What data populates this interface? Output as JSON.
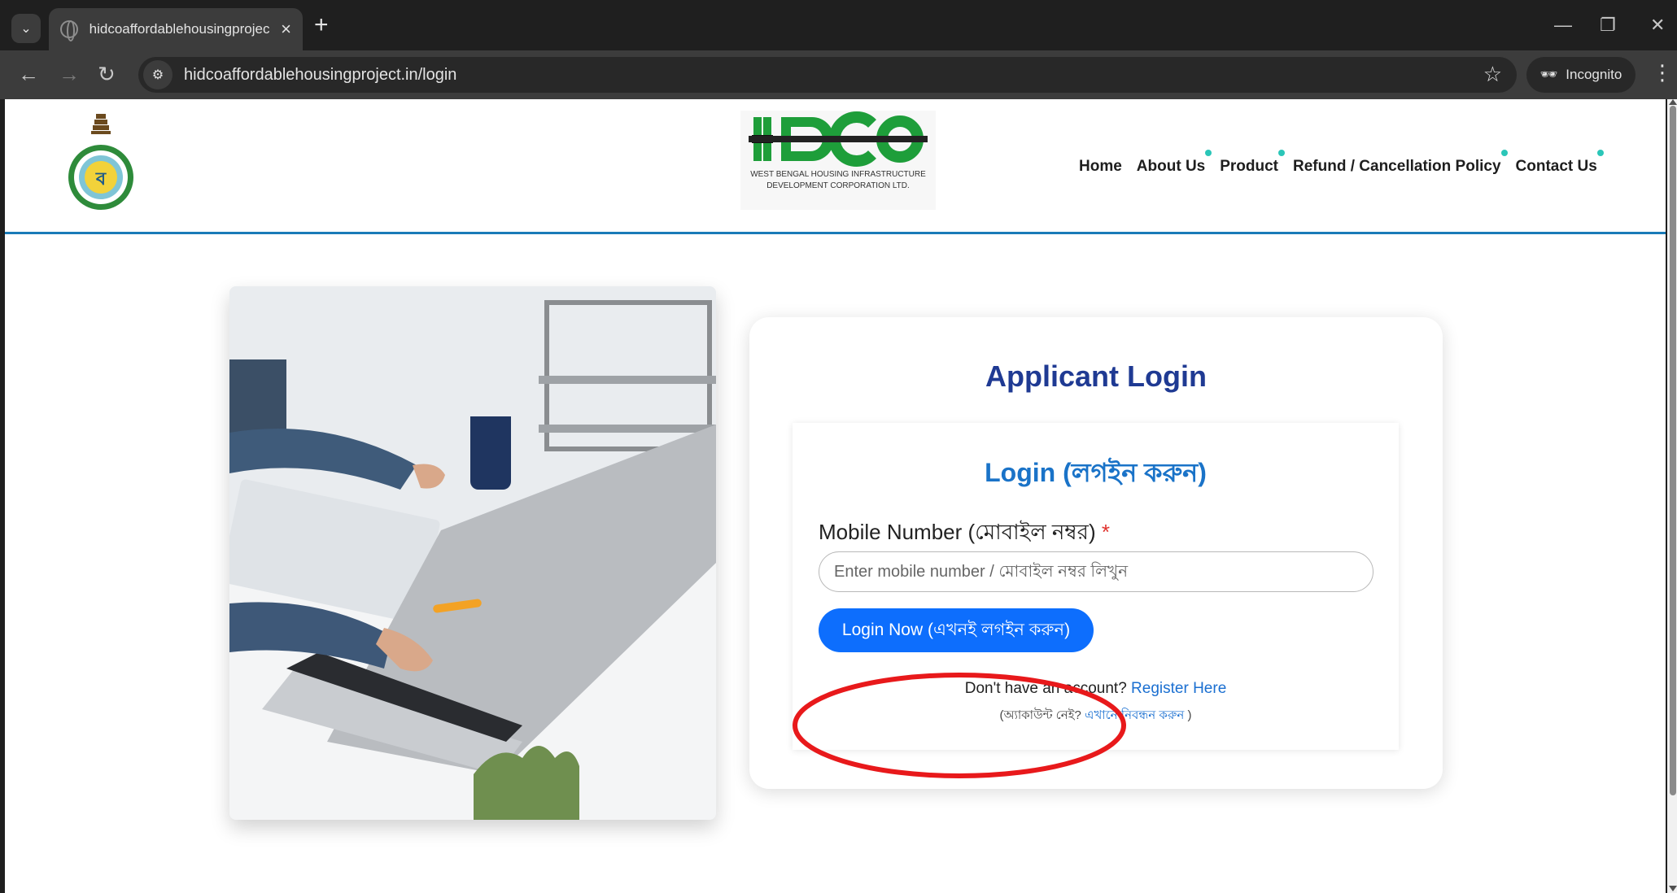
{
  "browser": {
    "tab_title": "hidcoaffordablehousingproject.",
    "url": "hidcoaffordablehousingproject.in/login",
    "incognito_label": "Incognito"
  },
  "header": {
    "logo_text": "WEST BENGAL HOUSING INFRASTRUCTURE DEVELOPMENT CORPORATION LTD.",
    "nav": [
      "Home",
      "About Us",
      "Product",
      "Refund / Cancellation Policy",
      "Contact Us"
    ]
  },
  "login": {
    "card_title": "Applicant Login",
    "form_title": "Login (লগইন করুন)",
    "mobile_label": "Mobile Number (মোবাইল নম্বর)",
    "required_mark": "*",
    "mobile_placeholder": "Enter mobile number / মোবাইল নম্বর লিখুন",
    "mobile_value": "",
    "button_label": "Login Now (এখনই লগইন করুন)",
    "no_account_text": "Don't have an account?",
    "register_link": "Register Here",
    "bn_no_account_text": "(অ্যাকাউন্ট নেই?",
    "bn_register_link": "এখানে নিবন্ধন করুন",
    "bn_close": ")"
  },
  "colors": {
    "primary_button": "#0d6efd",
    "card_title": "#1f3a93",
    "form_title": "#1a73c8",
    "highlight_ellipse": "#e8191b"
  }
}
